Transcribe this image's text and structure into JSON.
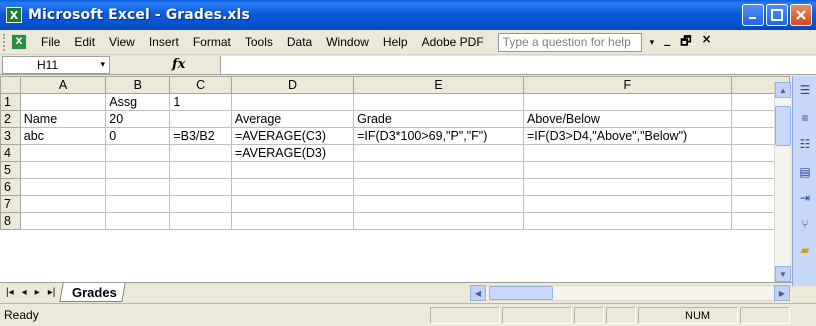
{
  "window": {
    "title": "Microsoft Excel - Grades.xls",
    "app_icon_glyph": "X",
    "buttons": [
      "minimize",
      "maximize",
      "close"
    ],
    "colors": {
      "titlebar": "#0a5bd9",
      "close": "#d3491c"
    }
  },
  "menubar": {
    "doc_icon_glyph": "X",
    "items": [
      "File",
      "Edit",
      "View",
      "Insert",
      "Format",
      "Tools",
      "Data",
      "Window",
      "Help",
      "Adobe PDF"
    ],
    "help_box_placeholder": "Type a question for help",
    "help_drop": "▾",
    "doc_controls": [
      "_",
      "🗗",
      "×"
    ]
  },
  "formulabar": {
    "name_box": "H11",
    "name_drop": "▾",
    "fx_label": "fx",
    "formula": ""
  },
  "sheet": {
    "column_headers": [
      "A",
      "B",
      "C",
      "D",
      "E",
      "F"
    ],
    "row_headers": [
      "1",
      "2",
      "3",
      "4",
      "5",
      "6",
      "7",
      "8"
    ],
    "cells": [
      [
        "",
        "Assg",
        "1",
        "",
        "",
        ""
      ],
      [
        "Name",
        "20",
        "",
        "Average",
        "Grade",
        "Above/Below"
      ],
      [
        "abc",
        "0",
        "=B3/B2",
        "=AVERAGE(C3)",
        "=IF(D3*100>69,\"P\",\"F\")",
        "=IF(D3>D4,\"Above\",\"Below\")"
      ],
      [
        "",
        "",
        "",
        "=AVERAGE(D3)",
        "",
        ""
      ],
      [
        "",
        "",
        "",
        "",
        "",
        ""
      ],
      [
        "",
        "",
        "",
        "",
        "",
        ""
      ],
      [
        "",
        "",
        "",
        "",
        "",
        ""
      ],
      [
        "",
        "",
        "",
        "",
        "",
        ""
      ]
    ]
  },
  "tabs": {
    "nav": [
      "|◂",
      "◂",
      "▸",
      "▸|"
    ],
    "sheets": [
      "Grades"
    ]
  },
  "statusbar": {
    "status": "Ready",
    "num": "NUM"
  },
  "right_toolbar_icons": [
    "align-left-icon",
    "align-right-icon",
    "indent-icon",
    "list-icon",
    "outdent-icon",
    "merge-icon",
    "folder-icon"
  ]
}
